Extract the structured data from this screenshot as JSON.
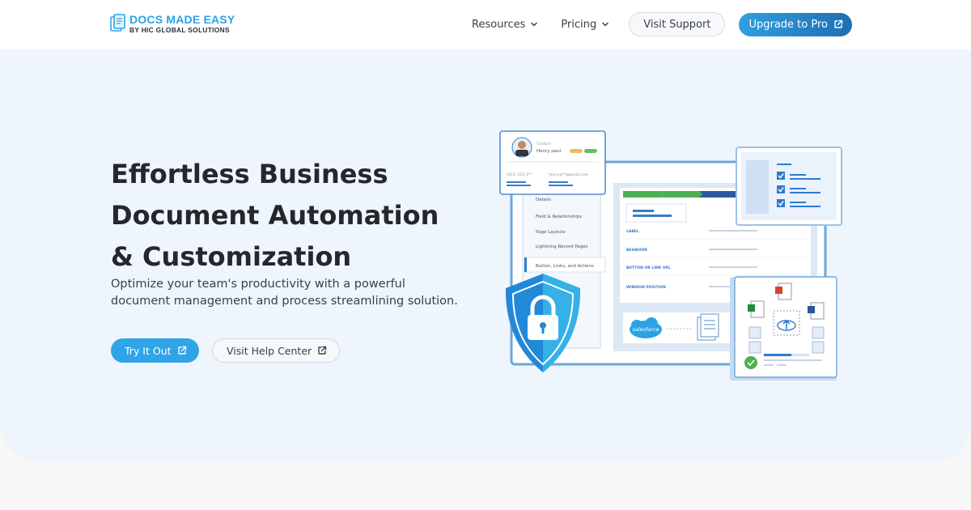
{
  "header": {
    "logo": {
      "title": "DOCS MADE EASY",
      "subtitle": "BY HIC GLOBAL SOLUTIONS",
      "icon": "documents-icon"
    },
    "nav": {
      "resources_label": "Resources",
      "pricing_label": "Pricing",
      "support_label": "Visit Support",
      "upgrade_label": "Upgrade to Pro"
    }
  },
  "hero": {
    "headline": [
      "Effortless Business",
      "Document Automation",
      "& Customization"
    ],
    "subtext": "Optimize your team's productivity with a powerful document management and process streamlining solution.",
    "try_label": "Try It Out",
    "help_label": "Visit Help Center"
  },
  "illustration": {
    "contact_label": "Contact",
    "contact_name": "Henry paul",
    "contact_phone": "(415) 223-1**",
    "contact_email": "henry.p**@gmail.com",
    "menu_items": [
      "Details",
      "Field & Relationships",
      "Page Layouts",
      "Lightning Record Pages",
      "Button, Links, and Actions"
    ],
    "field_labels": [
      "LABEL",
      "BEHAVIOR",
      "BUTTON OR LINK URL",
      "WINDOW POSITION"
    ],
    "salesforce_label": "salesforce"
  },
  "colors": {
    "accent": "#2fa5e8",
    "accent_dark": "#1d6fb3",
    "hero_bg": "#eef5fd",
    "heading": "#24272c"
  }
}
